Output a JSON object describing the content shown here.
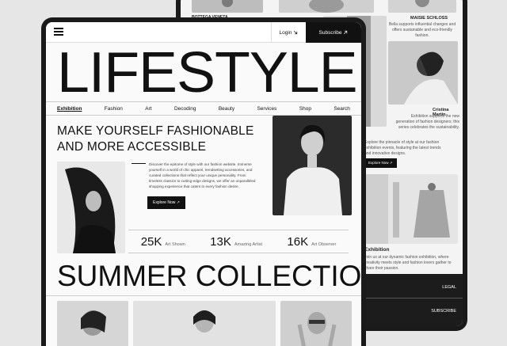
{
  "back_page": {
    "top_caption": "BOTTEGA VENETA",
    "model1_name": "MAISIE SCHLOSS",
    "model1_desc": "Bella supports influential changes and offers sustainable and eco-friendly fashion.",
    "model2_name": "Cristina Martin",
    "model2_desc": "Exhibition supports the new generation of fashion designers; this series celebrates the sustainability.",
    "intro_text": "Explore the pinnacle of style at our fashion exhibition events, featuring the latest trends and innovative designs.",
    "explore_label": "Explore Now ↗",
    "section_title": "Exhibition",
    "section_desc": "Join us at our dynamic fashion exhibition, where creativity meets style and fashion lovers gather to share their passion.",
    "footer_legal": "LEGAL",
    "footer_subscribe": "SUBSCRIBE"
  },
  "header": {
    "login_label": "Login",
    "subscribe_label": "Subscribe"
  },
  "hero": {
    "title": "LIFESTYLE",
    "headline": "MAKE YOURSELF FASHIONABLE AND MORE ACCESSIBLE",
    "description": "Discover the epitome of style with our fashion website. Immerse yourself in a world of chic apparel, trendsetting accessories, and curated collections that reflect your unique personality. From timeless classics to cutting-edge designs, we offer an unparalleled shopping experience that caters to every fashion desire.",
    "explore_label": "Explore Now ↗"
  },
  "nav": {
    "items": [
      "Exhibition",
      "Fashion",
      "Art",
      "Decoding",
      "Beauty",
      "Services",
      "Shop",
      "Search"
    ]
  },
  "stats": [
    {
      "value": "25K",
      "label": "Art Shown"
    },
    {
      "value": "13K",
      "label": "Amazing Artist"
    },
    {
      "value": "16K",
      "label": "Art Observer"
    }
  ],
  "collection": {
    "title": "SUMMER COLLECTION"
  },
  "icons": {
    "menu": "hamburger-menu-icon",
    "login": "user-icon",
    "arrow": "arrow-up-right-icon"
  },
  "colors": {
    "background": "#e6e6e6",
    "device": "#1a1a1a",
    "accent": "#111111"
  }
}
